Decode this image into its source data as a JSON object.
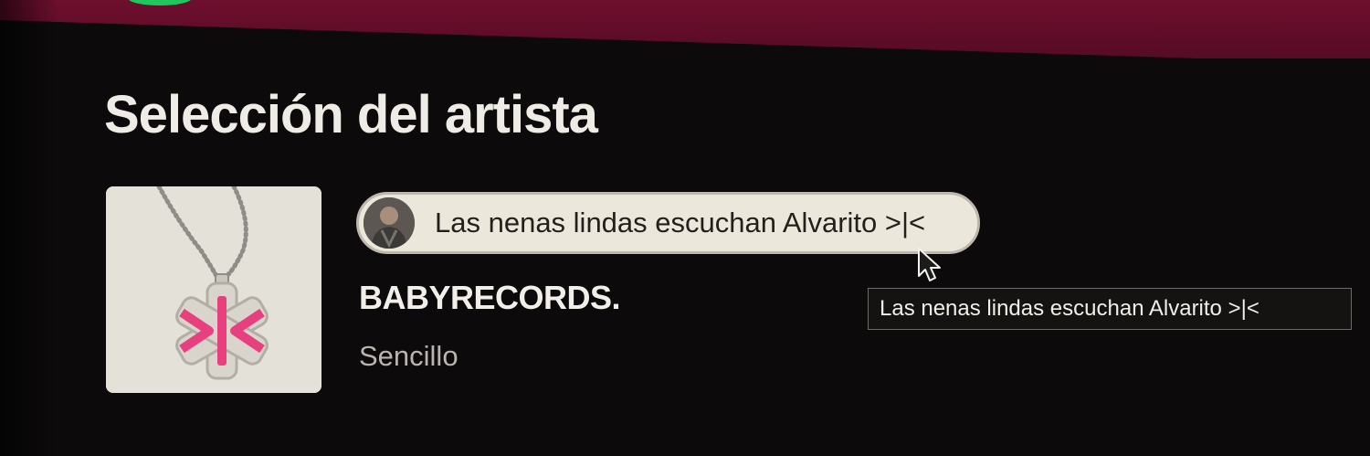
{
  "section": {
    "title": "Selección del artista"
  },
  "artist_pick": {
    "comment": "Las nenas lindas escuchan Alvarito >|<",
    "tooltip": "Las nenas lindas escuchan Alvarito >|<",
    "avatar_icon": "artist-avatar"
  },
  "release": {
    "title": "BABYRECORDS.",
    "type": "Sencillo",
    "cover_icon": "chain-pendant-cover"
  },
  "colors": {
    "banner": "#6e0f2e",
    "background": "#0c0a0b",
    "pill": "#ebe7da",
    "pendant_pink": "#e8407f"
  }
}
